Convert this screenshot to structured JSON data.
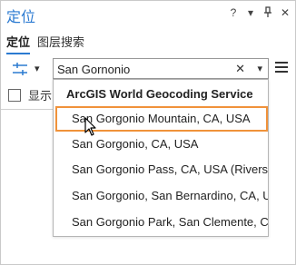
{
  "window": {
    "title": "定位",
    "help_icon": "?",
    "pin_icon": "pin-icon",
    "close_icon": "✕",
    "options_icon": "▾"
  },
  "tabs": [
    {
      "label": "定位",
      "active": true
    },
    {
      "label": "图层搜索",
      "active": false
    }
  ],
  "search": {
    "value": "San Gornonio",
    "clear_symbol": "✕",
    "dropdown_symbol": "▾"
  },
  "show_checkbox": {
    "label": "显示",
    "checked": false
  },
  "dropdown": {
    "header": "ArcGIS World Geocoding Service",
    "items": [
      {
        "label": "San Gorgonio Mountain, CA, USA",
        "selected": true
      },
      {
        "label": "San Gorgonio, CA, USA",
        "selected": false
      },
      {
        "label": "San Gorgonio Pass, CA, USA (Riverside",
        "selected": false
      },
      {
        "label": "San Gorgonio, San Bernardino, CA, U",
        "selected": false
      },
      {
        "label": "San Gorgonio Park, San Clemente, CA",
        "selected": false
      }
    ]
  },
  "colors": {
    "accent": "#2b7ad1",
    "highlight_border": "#f0923a"
  }
}
